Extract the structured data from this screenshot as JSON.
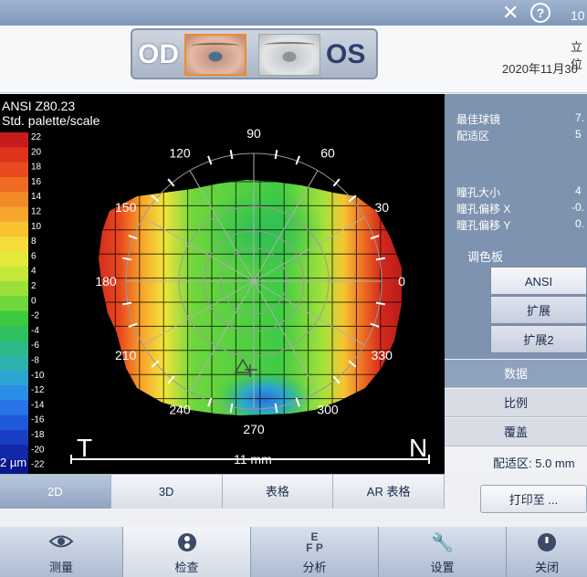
{
  "titlebar": {
    "close_icon": "close-icon",
    "help_glyph": "?",
    "number": "10"
  },
  "header": {
    "od_label": "OD",
    "os_label": "OS",
    "position_text": "立位",
    "date_text": "2020年11月30"
  },
  "map": {
    "scale_title_1": "ANSI Z80.23",
    "scale_title_2": "Std. palette/scale",
    "scale_unit": "2 µm",
    "label_temporal": "T",
    "label_nasal": "N",
    "diameter_label": "11 mm",
    "scale_ticks": [
      "22",
      "20",
      "18",
      "16",
      "14",
      "12",
      "10",
      "8",
      "6",
      "4",
      "2",
      "0",
      "-2",
      "-4",
      "-6",
      "-8",
      "-10",
      "-12",
      "-14",
      "-16",
      "-18",
      "-20",
      "-22"
    ],
    "scale_colors": [
      "#c51d1d",
      "#e0331c",
      "#ea4a1f",
      "#ef6a22",
      "#f28a27",
      "#f6a52d",
      "#f8c233",
      "#f4dd3a",
      "#e3ea3c",
      "#c4e83a",
      "#9be03a",
      "#6fd63d",
      "#3dc93f",
      "#2fc05d",
      "#2db986",
      "#2cb3ad",
      "#2ca5d3",
      "#2a8ee6",
      "#2674e8",
      "#1f58d9",
      "#183ec4",
      "#1128a8",
      "#0a168b"
    ],
    "angle_labels": [
      "0",
      "30",
      "60",
      "90",
      "120",
      "150",
      "180",
      "210",
      "240",
      "270",
      "300",
      "330"
    ]
  },
  "info": {
    "rows_top": [
      {
        "label": "最佳球镜",
        "value": "7."
      },
      {
        "label": "配适区",
        "value": "5"
      }
    ],
    "rows_pupil": [
      {
        "label": "瞳孔大小",
        "value": "4"
      },
      {
        "label": "瞳孔偏移 X",
        "value": "-0."
      },
      {
        "label": "瞳孔偏移 Y",
        "value": "0."
      }
    ],
    "palette_title": "调色板",
    "palette_options": [
      "ANSI",
      "扩展",
      "扩展2"
    ],
    "tab_data": "数据",
    "tab_scale": "比例",
    "tab_overlay": "覆盖",
    "zone_text": "配适区: 5.0 mm"
  },
  "view_tabs": [
    "2D",
    "3D",
    "表格",
    "AR 表格"
  ],
  "print_button": "打印至 ...",
  "nav": [
    {
      "label": "测量",
      "icon": "eye-icon"
    },
    {
      "label": "检查",
      "icon": "review-icon"
    },
    {
      "label": "分析",
      "icon": "chart-letters-icon"
    },
    {
      "label": "设置",
      "icon": "wrench-icon"
    },
    {
      "label": "关闭",
      "icon": "power-icon"
    }
  ]
}
